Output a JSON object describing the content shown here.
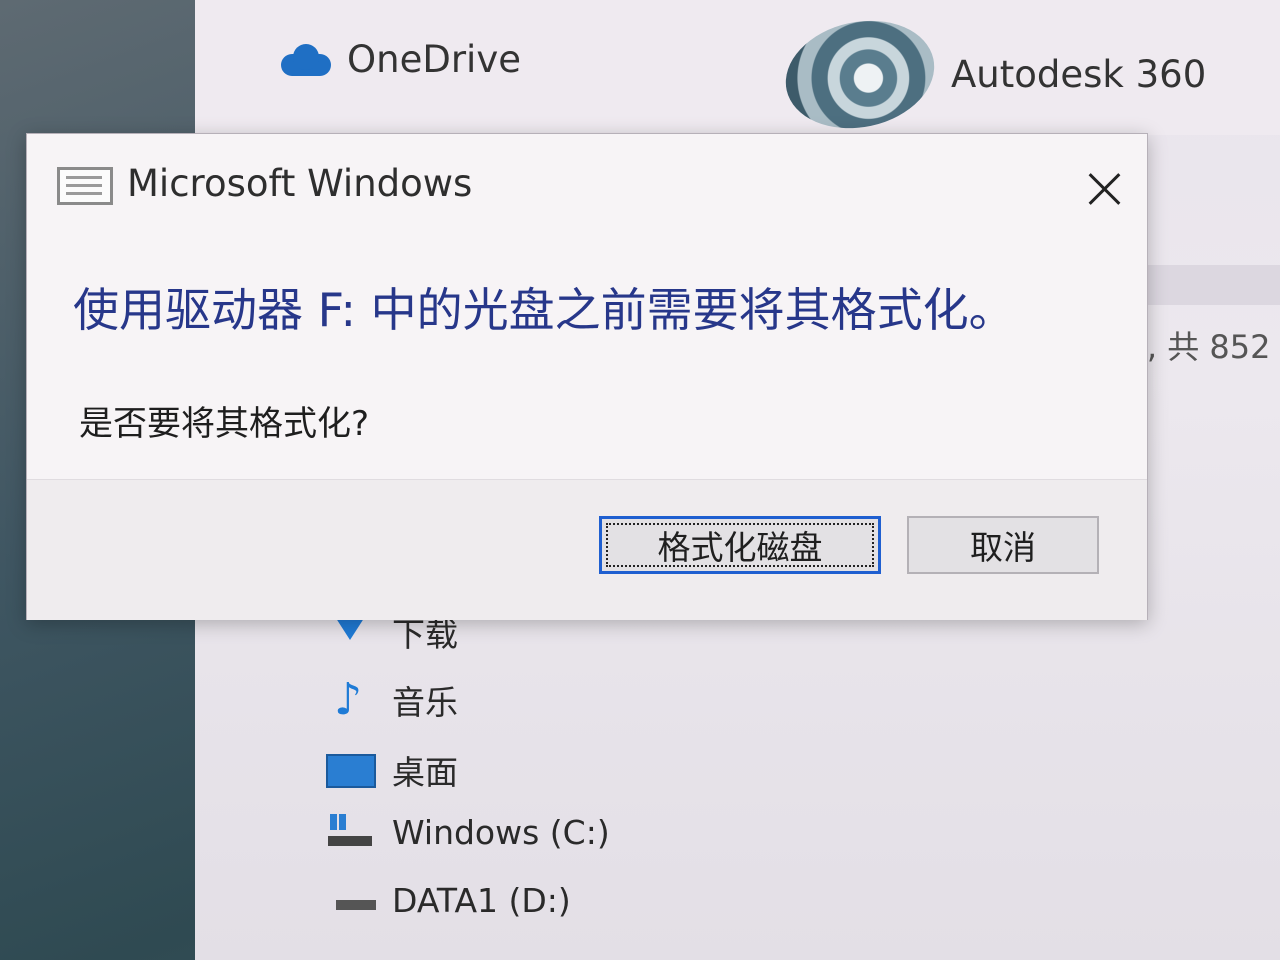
{
  "background_window": {
    "quick_access": [
      {
        "label": "OneDrive",
        "icon": "onedrive-cloud-icon"
      },
      {
        "label": "Autodesk 360",
        "icon": "autodesk-360-logo"
      }
    ],
    "status_fragment": "l, 共 852",
    "nav_items": [
      {
        "label": "下载",
        "icon": "download-arrow-icon"
      },
      {
        "label": "音乐",
        "icon": "music-note-icon"
      },
      {
        "label": "桌面",
        "icon": "desktop-icon"
      },
      {
        "label": "Windows (C:)",
        "icon": "windows-drive-icon"
      },
      {
        "label": "DATA1 (D:)",
        "icon": "drive-icon"
      }
    ]
  },
  "dialog": {
    "title": "Microsoft Windows",
    "icon": "app-window-icon",
    "close_symbol": "×",
    "message": "使用驱动器 F: 中的光盘之前需要将其格式化。",
    "question": "是否要将其格式化?",
    "buttons": {
      "format": "格式化磁盘",
      "cancel": "取消"
    },
    "accent_color": "#1f5fd0",
    "message_color": "#27378a"
  }
}
